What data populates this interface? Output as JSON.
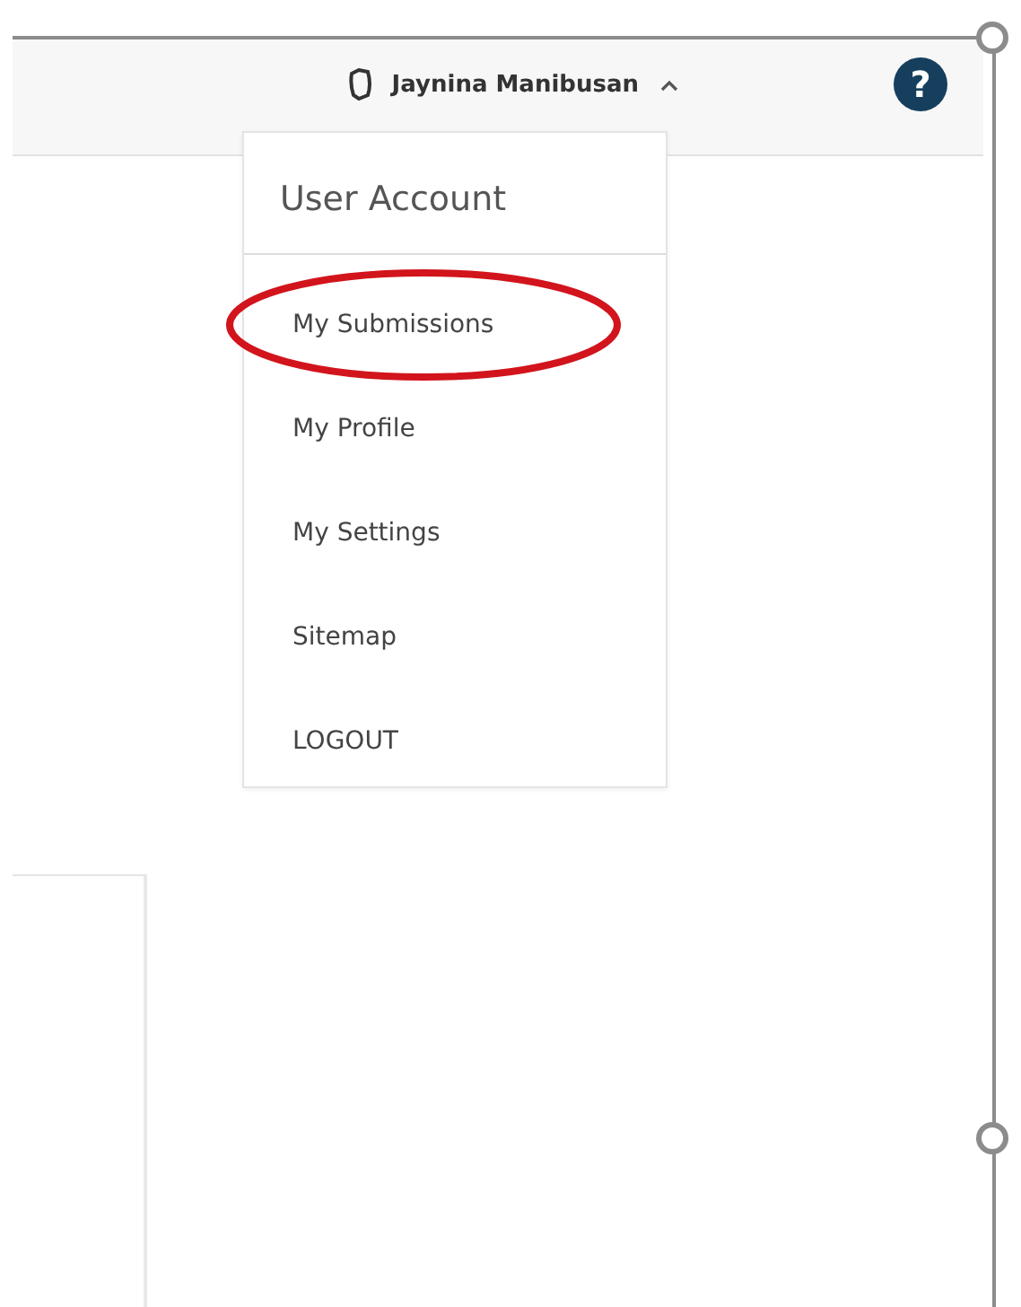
{
  "header": {
    "user_name": "Jaynina Manibusan",
    "expanded": true,
    "help_label": "?"
  },
  "user_menu": {
    "title": "User Account",
    "items": [
      {
        "label": "My Submissions",
        "circled": true
      },
      {
        "label": "My Profile",
        "circled": false
      },
      {
        "label": "My Settings",
        "circled": false
      },
      {
        "label": "Sitemap",
        "circled": false
      },
      {
        "label": "LOGOUT",
        "circled": false
      }
    ]
  }
}
